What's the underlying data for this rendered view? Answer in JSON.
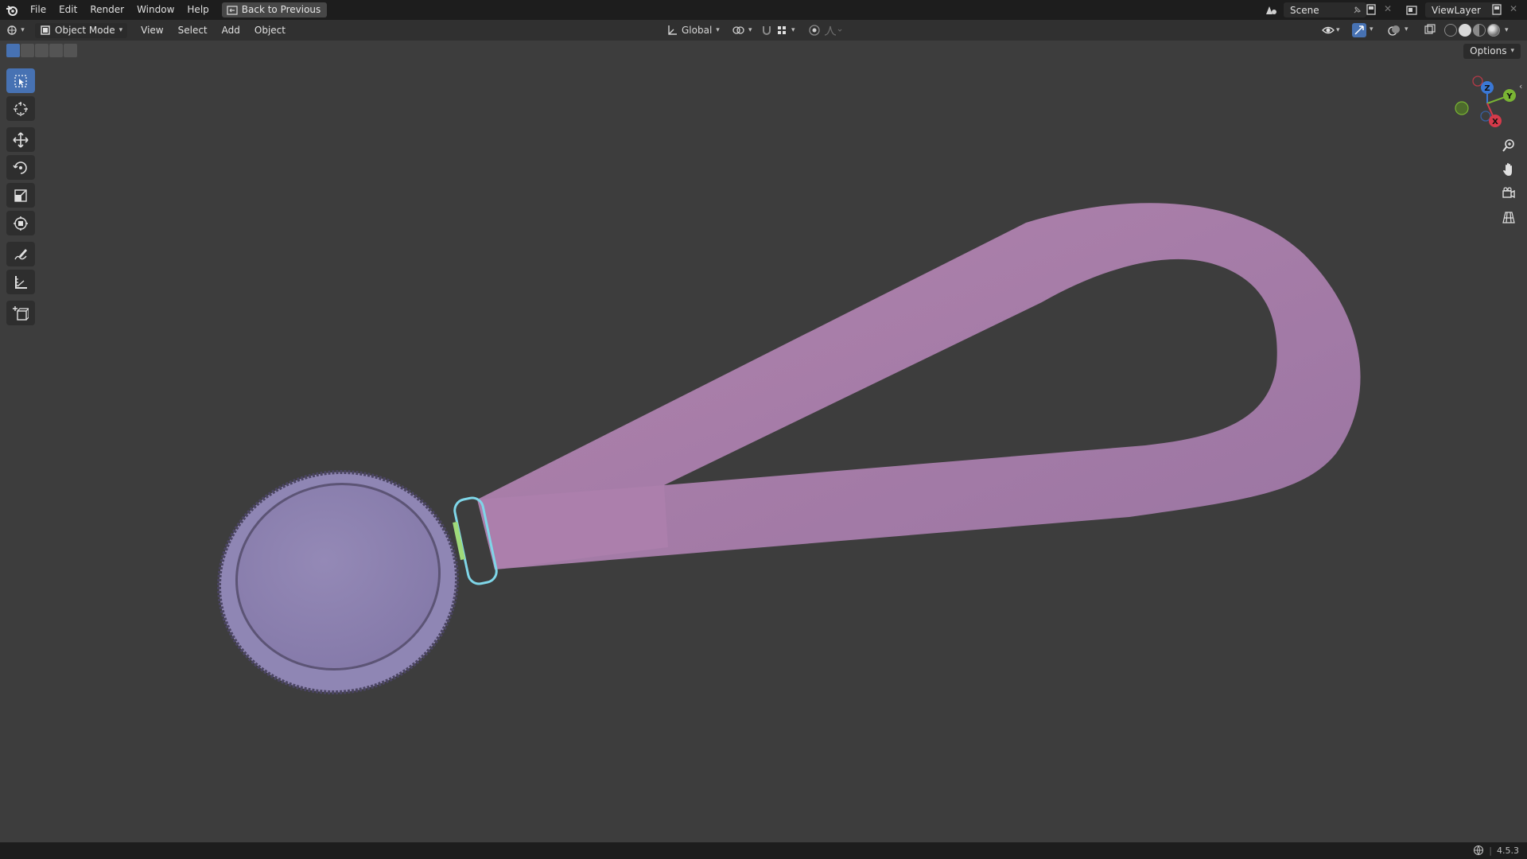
{
  "menu": {
    "file": "File",
    "edit": "Edit",
    "render": "Render",
    "window": "Window",
    "help": "Help"
  },
  "back_button": "Back to Previous",
  "scene": {
    "label": "Scene"
  },
  "view_layer": {
    "label": "ViewLayer"
  },
  "header": {
    "mode": "Object Mode",
    "view": "View",
    "select": "Select",
    "add": "Add",
    "object": "Object",
    "transform_orientation": "Global"
  },
  "options_label": "Options",
  "gizmo": {
    "z": "Z",
    "y": "Y",
    "x": "X"
  },
  "status": {
    "version": "4.5.3"
  },
  "colors": {
    "strap": "#a47aa6",
    "medal": "#8a80b0",
    "medal_edge": "#5c5475",
    "ring": "#7fd6e8",
    "accent": "#4772b3"
  },
  "tools": [
    "select-box-icon",
    "cursor-icon",
    "move-icon",
    "rotate-icon",
    "scale-icon",
    "transform-icon",
    "annotate-icon",
    "measure-icon",
    "add-cube-icon"
  ]
}
